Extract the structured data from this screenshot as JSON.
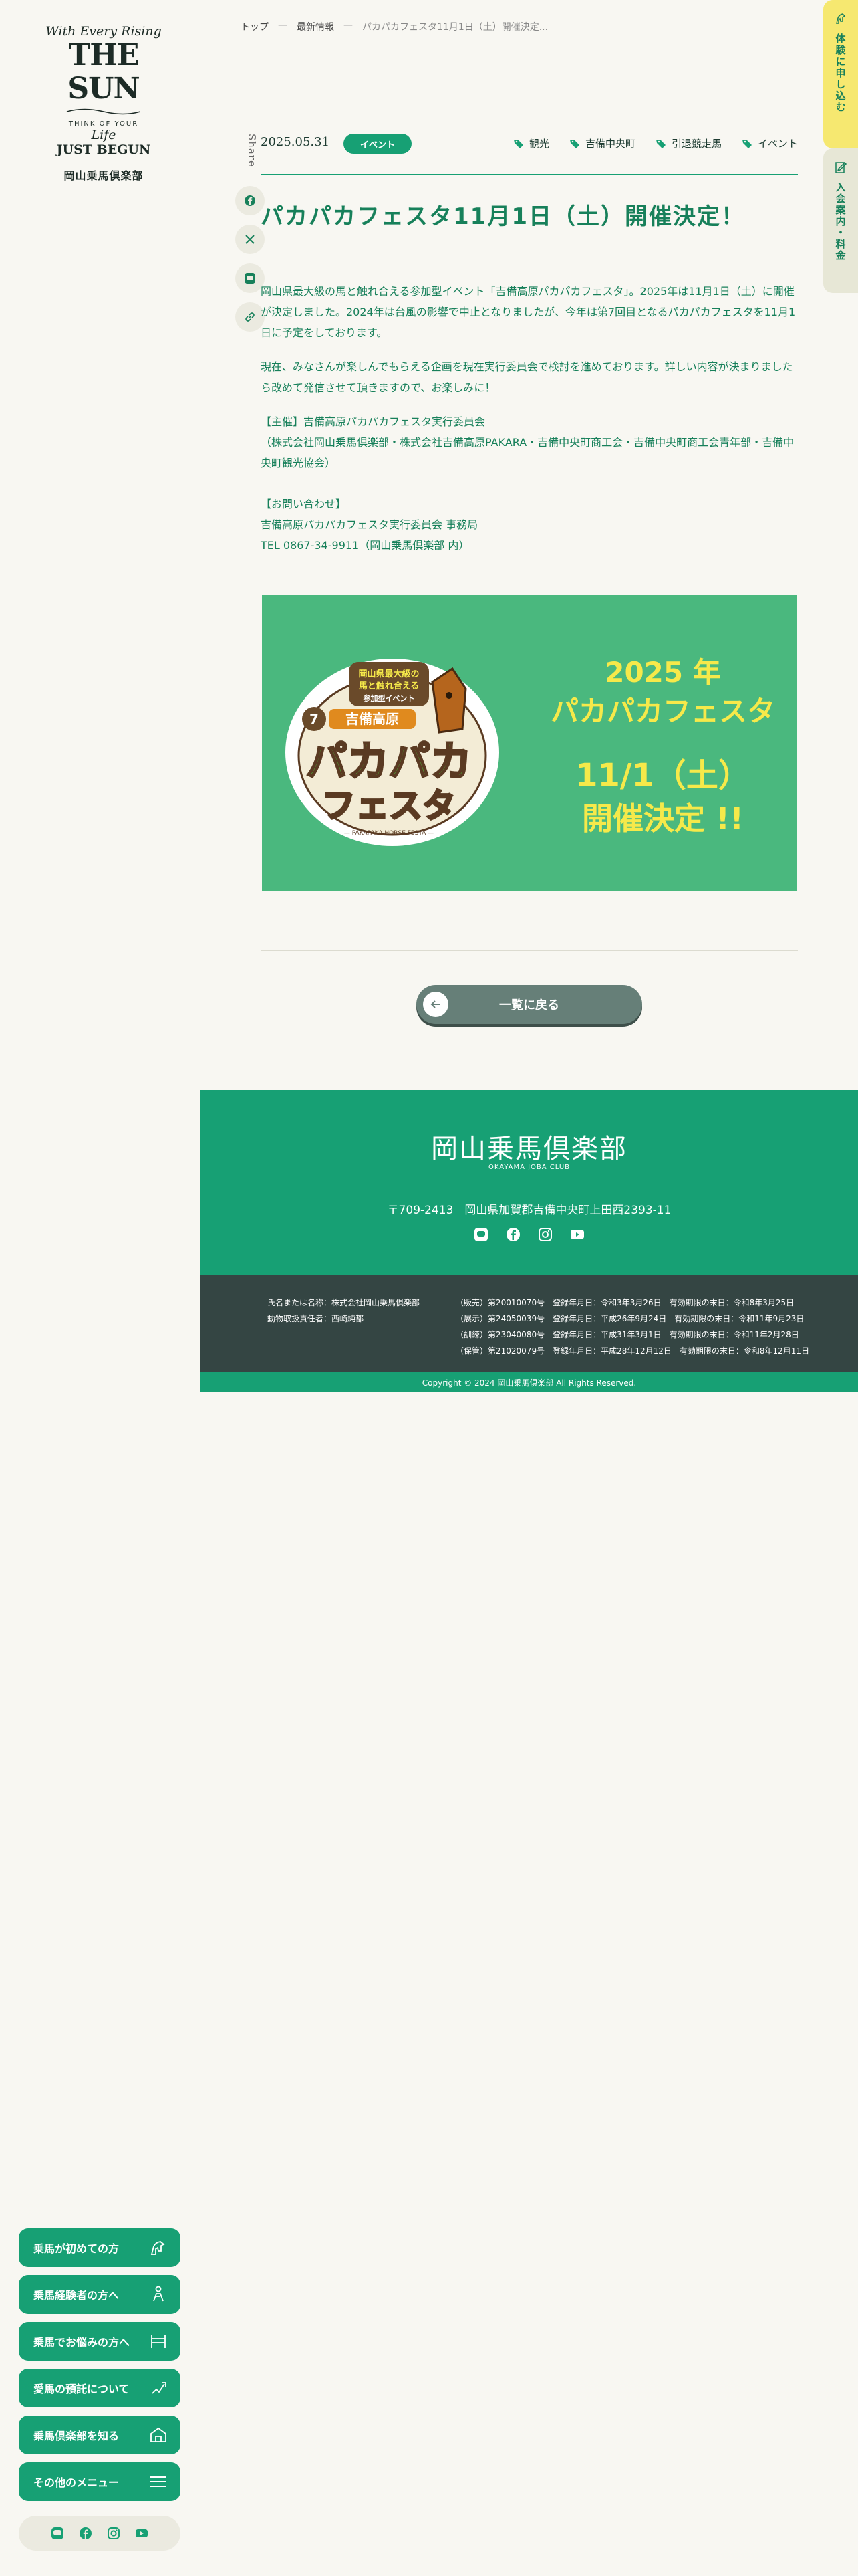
{
  "logo": {
    "script_top": "With Every Rising",
    "title": "THE SUN",
    "line1": "THINK OF YOUR",
    "script_mid": "Life",
    "line2": "JUST BEGUN",
    "club_name": "岡山乗馬倶楽部"
  },
  "side_tabs": {
    "trial": "体験に申し込む",
    "fee": "入会案内・料金"
  },
  "breadcrumb": {
    "home": "トップ",
    "news": "最新情報",
    "current": "パカパカフェスタ11月1日（土）開催決定..."
  },
  "share": {
    "label": "Share",
    "icons": [
      "facebook-icon",
      "x-icon",
      "line-icon",
      "link-icon"
    ]
  },
  "article": {
    "date": "2025.05.31",
    "category": "イベント",
    "tags": [
      "観光",
      "吉備中央町",
      "引退競走馬",
      "イベント"
    ],
    "title": "パカパカフェスタ11月1日（土）開催決定！",
    "para1": "岡山県最大級の馬と触れ合える参加型イベント「吉備高原パカパカフェスタ」。2025年は11月1日（土）に開催が決定しました。2024年は台風の影響で中止となりましたが、今年は第7回目となるパカパカフェスタを11月1日に予定をしております。",
    "para2": "現在、みなさんが楽しんでもらえる企画を現在実行委員会で検討を進めております。詳しい内容が決まりましたら改めて発信させて頂きますので、お楽しみに！",
    "organizer_label": "【主催】吉備高原パカパカフェスタ実行委員会",
    "organizer_detail": "（株式会社岡山乗馬倶楽部・株式会社吉備高原PAKARA・吉備中央町商工会・吉備中央町商工会青年部・吉備中央町観光協会）",
    "contact_label": "【お問い合わせ】",
    "contact_name": "吉備高原パカパカフェスタ実行委員会 事務局",
    "contact_tel": "TEL 0867-34-9911（岡山乗馬倶楽部 内）"
  },
  "banner": {
    "badge_line1": "岡山県最大級の",
    "badge_line2": "馬と触れ合える",
    "badge_line3": "参加型イベント",
    "badge_number": "7",
    "badge_place": "吉備高原",
    "badge_main": "パカパカ",
    "badge_sub": "フェスタ",
    "badge_footer": "— PAKAPAKA HORSE FESTA —",
    "year": "2025 年",
    "name": "パカパカフェスタ",
    "date": "11/1（土）",
    "decided": "開催決定 !!"
  },
  "back_button": "一覧に戻る",
  "footer": {
    "logo": "岡山乗馬倶楽部",
    "logo_sub": "OKAYAMA JOBA CLUB",
    "address": "〒709-2413　岡山県加賀郡吉備中央町上田西2393-11",
    "social": [
      "line-icon",
      "facebook-icon",
      "instagram-icon",
      "youtube-icon"
    ],
    "reg_left": [
      "氏名または名称：株式会社岡山乗馬倶楽部",
      "動物取扱責任者：西崎純都"
    ],
    "reg_right": [
      "（販売）第20010070号　登録年月日：令和3年3月26日　有効期限の末日：令和8年3月25日",
      "（展示）第24050039号　登録年月日：平成26年9月24日　有効期限の末日：令和11年9月23日",
      "（訓練）第23040080号　登録年月日：平成31年3月1日　有効期限の末日：令和11年2月28日",
      "（保管）第21020079号　登録年月日：平成28年12月12日　有効期限の末日：令和8年12月11日"
    ],
    "copyright": "Copyright © 2024 岡山乗馬倶楽部 All Rights Reserved."
  },
  "left_menu": [
    "乗馬が初めての方",
    "乗馬経験者の方へ",
    "乗馬でお悩みの方へ",
    "愛馬の預託について",
    "乗馬倶楽部を知る",
    "その他のメニュー"
  ],
  "colors": {
    "brand_green": "#17a074",
    "text_green": "#17805a",
    "background": "#f8f7f2",
    "banner_green": "#4ab87e",
    "banner_yellow": "#f6e94a",
    "trial_yellow": "#f6e870",
    "dark_footer": "#344543"
  }
}
